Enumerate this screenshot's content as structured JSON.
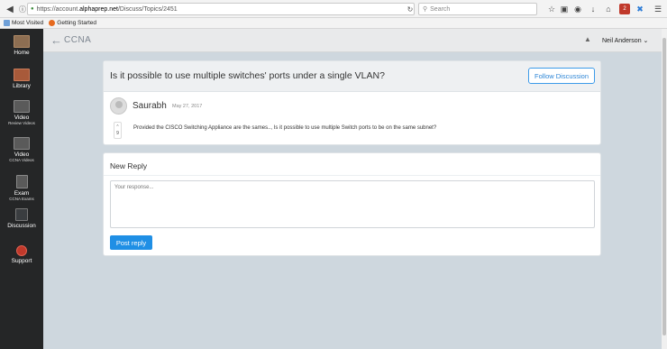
{
  "browser": {
    "url_prefix": "https://account.",
    "url_host": "alphaprep.net",
    "url_path": "/Discuss/Topics/2451",
    "search_placeholder": "Search",
    "bookmarks": [
      "Most Visited",
      "Getting Started"
    ]
  },
  "sidebar": {
    "items": [
      {
        "label": "Home",
        "sub": "",
        "icon": "home-icon"
      },
      {
        "label": "Library",
        "sub": "",
        "icon": "library-icon"
      },
      {
        "label": "Video",
        "sub": "Review Videos",
        "icon": "video-icon"
      },
      {
        "label": "Video",
        "sub": "CCNA Videos",
        "icon": "video-icon"
      },
      {
        "label": "Exam",
        "sub": "CCNA Exams",
        "icon": "exam-icon"
      },
      {
        "label": "Discussion",
        "sub": "",
        "icon": "discussion-icon"
      },
      {
        "label": "Support",
        "sub": "",
        "icon": "support-icon"
      }
    ]
  },
  "header": {
    "course": "CCNA",
    "user": "Neil Anderson"
  },
  "question": {
    "title": "Is it possible to use multiple switches' ports under a single VLAN?",
    "follow_label": "Follow Discussion",
    "author": "Saurabh",
    "date": "May 27, 2017",
    "votes": "9",
    "body": "Provided the CISCO Switching Appliance are the sames.., Is it possible to use multiple Switch ports to be on the same subnet?"
  },
  "reply": {
    "title": "New Reply",
    "placeholder": "Your response...",
    "button": "Post reply"
  },
  "colors": {
    "sidebar_bg": "#252627",
    "accent": "#1f8fe5",
    "page_bg": "#ced7de"
  }
}
